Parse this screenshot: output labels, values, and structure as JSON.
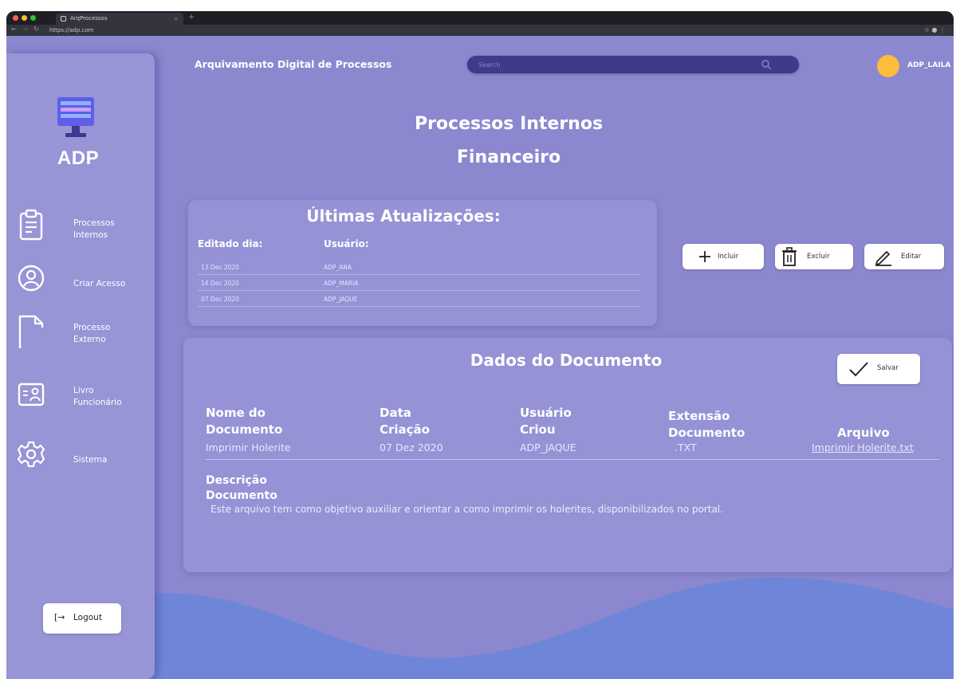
{
  "browser": {
    "tab_title": "ArqProcessos",
    "url": "https://adp.com"
  },
  "app": {
    "title": "Arquivamento Digital de Processos",
    "logo_text": "ADP",
    "user": "ADP_LAILA"
  },
  "search": {
    "placeholder": "Search"
  },
  "sidebar": {
    "items": [
      {
        "label_line1": "Processos",
        "label_line2": "Internos",
        "icon": "document-list-icon"
      },
      {
        "label_line1": "Criar Acesso",
        "label_line2": "",
        "icon": "user-circle-icon"
      },
      {
        "label_line1": "Processo",
        "label_line2": "Externo",
        "icon": "document-icon"
      },
      {
        "label_line1": "Livro",
        "label_line2": "Funcionário",
        "icon": "id-card-icon"
      },
      {
        "label_line1": "Sistema",
        "label_line2": "",
        "icon": "gear-icon"
      }
    ],
    "logout_label": "Logout"
  },
  "page": {
    "title": "Processos Internos",
    "subtitle": "Financeiro"
  },
  "updates": {
    "title": "Últimas Atualizações:",
    "col_date": "Editado dia:",
    "col_user": "Usuário:",
    "rows": [
      {
        "date": "13 Dec 2020",
        "user": "ADP_ANA"
      },
      {
        "date": "14 Dec 2020",
        "user": "ADP_MARIA"
      },
      {
        "date": "07 Dec 2020",
        "user": "ADP_JAQUE"
      }
    ]
  },
  "actions": {
    "include": "Incluir",
    "delete": "Excluir",
    "edit": "Editar"
  },
  "document": {
    "title": "Dados do Documento",
    "save_label": "Salvar",
    "headers": {
      "name_1": "Nome do",
      "name_2": "Documento",
      "date_1": "Data",
      "date_2": "Criação",
      "user_1": "Usuário",
      "user_2": "Criou",
      "ext_1": "Extensão",
      "ext_2": "Documento",
      "file": "Arquivo"
    },
    "row": {
      "name": "Imprimir Holerite",
      "date": "07 Dez 2020",
      "user": "ADP_JAQUE",
      "ext": ".TXT",
      "file": "Imprimir Holerite.txt"
    },
    "desc_head_1": "Descrição",
    "desc_head_2": "Documento",
    "description": "Este arquivo tem como objetivo auxiliar e orientar a como imprimir os holerites, disponibilizados no portal."
  },
  "colors": {
    "background": "#8b88cf",
    "sidebar": "#9795d6",
    "wave": "#6f86d8",
    "search_bg": "#3f3b8a",
    "avatar": "#fbbd3a"
  }
}
